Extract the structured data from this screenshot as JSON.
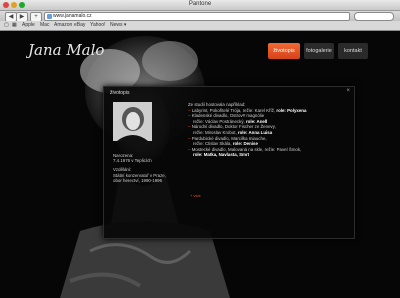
{
  "window": {
    "title": "Pantone"
  },
  "toolbar": {
    "back": "◀",
    "forward": "▶",
    "add": "+",
    "url": "www.janamalo.cz"
  },
  "bookmarks": [
    "Apple",
    "Mac",
    "Amazon",
    "eBay",
    "Yahoo!",
    "News ▾"
  ],
  "site": {
    "logo": "Jana Malo",
    "nav": [
      "životopis",
      "fotogalerie",
      "kontakt"
    ],
    "colors": {
      "accent": "#e8541f",
      "background": "#060606"
    }
  },
  "panel": {
    "title": "životopis",
    "close": "×",
    "born_label": "Narozena:",
    "born_value": "7.4.1976 v Teplicích",
    "edu_label": "Vzdělání:",
    "edu_line1": "Státní konzervatoř v Praze,",
    "edu_line2": "obor herectví, 1990-1996",
    "intro": "Ze studií hostovala například:",
    "list": [
      {
        "text": "Labyrint, Pokořitelé Trója, režie: Karel Kříž, ",
        "role": "role: Polyxena",
        "bullet": true
      },
      {
        "text": "Kladenské divadlo, Ostrov# magnólie",
        "role": "",
        "bullet": true
      },
      {
        "text": "režie: Václav Postránecký, ",
        "role": "role: Anell",
        "bullet": false
      },
      {
        "text": "Národní divadlo, Doktor Fischer ze Ženevy,",
        "role": "",
        "bullet": true
      },
      {
        "text": "režie: Miroslav Krobot, ",
        "role": "role: Anna Luisa",
        "bullet": false
      },
      {
        "text": "Pardubické divadlo, Marcilka Iniauche,",
        "role": "",
        "bullet": true
      },
      {
        "text": "režie: Ctislav Skála, ",
        "role": "role: Denise",
        "bullet": false
      },
      {
        "text": "Mostecké divadlo, Malovaná na skle, režie: Pavel Šmok,",
        "role": "",
        "bullet": true
      },
      {
        "text": "",
        "role": "role: Matka, Navlasta, Smrt",
        "bullet": false
      }
    ],
    "more": "+ více"
  }
}
